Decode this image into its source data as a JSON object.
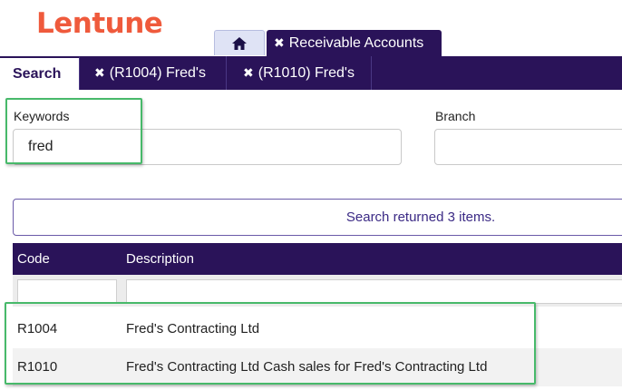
{
  "app": {
    "logo": "Lentune"
  },
  "top_tabs": {
    "home_icon": "home-icon",
    "module_label": "Receivable Accounts"
  },
  "sub_tabs": [
    {
      "label": "Search"
    },
    {
      "label": "(R1004) Fred's"
    },
    {
      "label": "(R1010) Fred's"
    }
  ],
  "search_form": {
    "keywords_label": "Keywords",
    "keywords_value": "fred",
    "branch_label": "Branch",
    "branch_value": ""
  },
  "result_message": "Search returned 3 items.",
  "grid": {
    "columns": [
      "Code",
      "Description"
    ],
    "rows": [
      {
        "code": "R1004",
        "description": "Fred's Contracting Ltd"
      },
      {
        "code": "R1010",
        "description": "Fred's Contracting Ltd Cash sales for Fred's Contracting Ltd"
      }
    ]
  },
  "colors": {
    "brand": "#ef5a3c",
    "primary": "#2a1359",
    "highlight": "#47b96a"
  }
}
